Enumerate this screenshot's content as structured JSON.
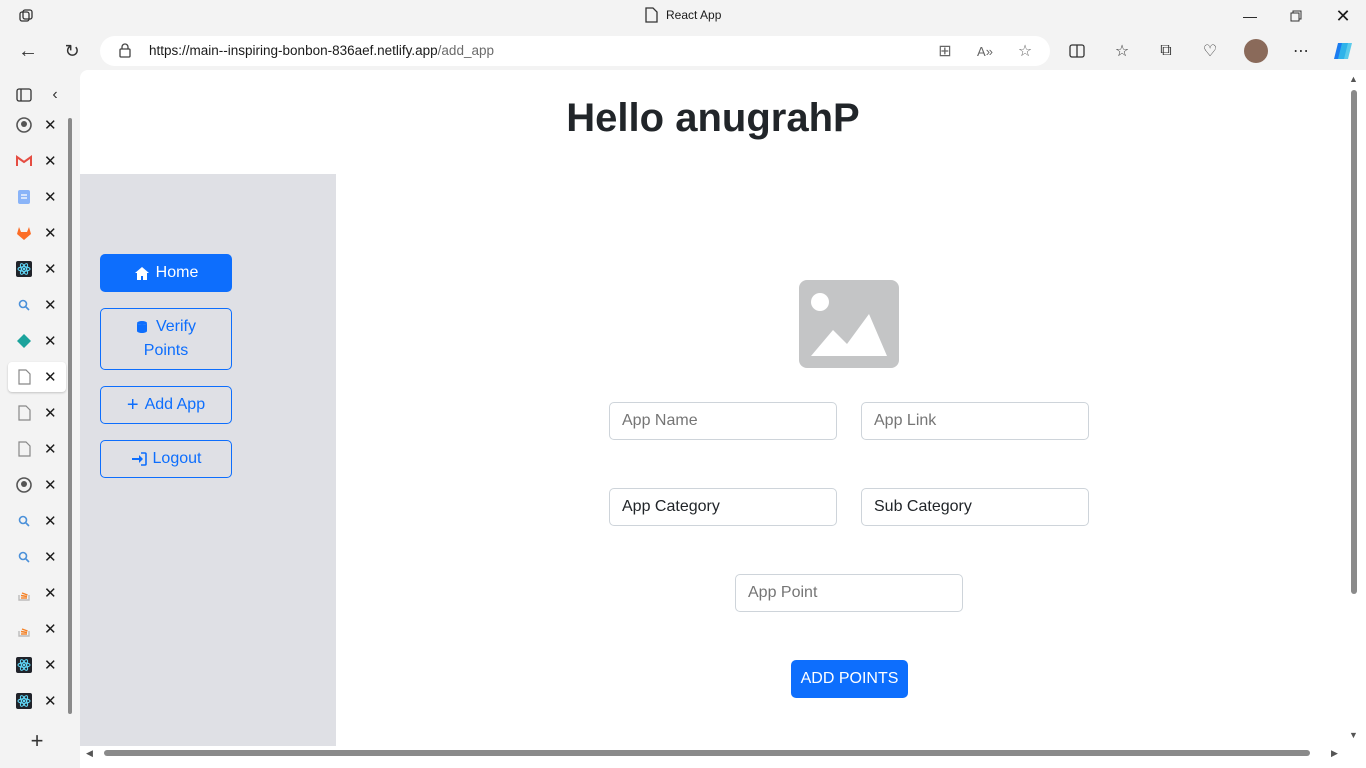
{
  "window": {
    "tab_title": "React App"
  },
  "address_bar": {
    "url_main": "https://main--inspiring-bonbon-836aef.netlify.app",
    "url_path": "/add_app"
  },
  "page": {
    "greeting": "Hello anugrahP",
    "sidebar": {
      "home": "Home",
      "verify_line1": "Verify",
      "verify_line2": "Points",
      "add_app": "Add App",
      "logout": "Logout"
    },
    "form": {
      "app_name_placeholder": "App Name",
      "app_link_placeholder": "App Link",
      "app_category_value": "App Category",
      "sub_category_value": "Sub Category",
      "app_point_placeholder": "App Point",
      "submit_label": "ADD POINTS"
    }
  },
  "vertical_tabs": [
    {
      "icon": "github-icon"
    },
    {
      "icon": "gmail-icon"
    },
    {
      "icon": "docs-icon"
    },
    {
      "icon": "gitlab-icon"
    },
    {
      "icon": "react-icon"
    },
    {
      "icon": "search-icon"
    },
    {
      "icon": "diamond-icon"
    },
    {
      "icon": "page-icon"
    },
    {
      "icon": "page-icon"
    },
    {
      "icon": "page-icon"
    },
    {
      "icon": "github-icon"
    },
    {
      "icon": "search-icon"
    },
    {
      "icon": "search-icon"
    },
    {
      "icon": "stackoverflow-icon"
    },
    {
      "icon": "stackoverflow-icon"
    },
    {
      "icon": "react-icon"
    },
    {
      "icon": "react-icon"
    }
  ],
  "colors": {
    "primary": "#0d6efd",
    "sidebar_bg": "#dfe0e5",
    "heading": "#212529"
  }
}
